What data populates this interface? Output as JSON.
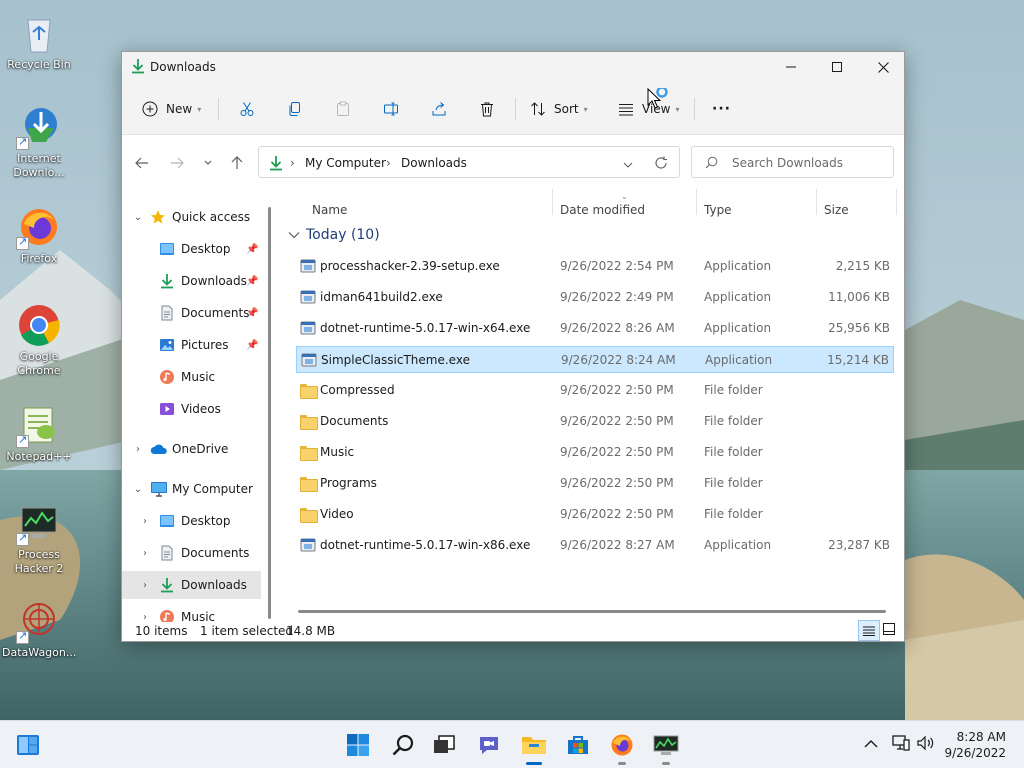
{
  "desktop": {
    "icons": [
      {
        "label": "Recycle Bin",
        "icon": "recycle-bin-icon"
      },
      {
        "label": "Internet Downlo...",
        "icon": "internet-download-manager-icon"
      },
      {
        "label": "Firefox",
        "icon": "firefox-icon"
      },
      {
        "label": "Google Chrome",
        "icon": "chrome-icon"
      },
      {
        "label": "Notepad++",
        "icon": "notepad-plus-plus-icon"
      },
      {
        "label": "Process Hacker 2",
        "icon": "process-hacker-icon"
      },
      {
        "label": "DataWagon...",
        "icon": "datawagon-icon"
      }
    ]
  },
  "window": {
    "title": "Downloads",
    "commands": {
      "new_label": "New",
      "sort_label": "Sort",
      "view_label": "View",
      "more_label": "···"
    },
    "address": {
      "crumbs": [
        "My Computer",
        "Downloads"
      ]
    },
    "search": {
      "placeholder": "Search Downloads"
    },
    "sidebar": {
      "items": [
        {
          "label": "Quick access",
          "icon": "star-icon",
          "level": 0,
          "expanded": true
        },
        {
          "label": "Desktop",
          "icon": "desktop-folder-icon",
          "level": 1,
          "pinned": true
        },
        {
          "label": "Downloads",
          "icon": "downloads-icon",
          "level": 1,
          "pinned": true
        },
        {
          "label": "Documents",
          "icon": "documents-icon",
          "level": 1,
          "pinned": true
        },
        {
          "label": "Pictures",
          "icon": "pictures-icon",
          "level": 1,
          "pinned": true
        },
        {
          "label": "Music",
          "icon": "music-icon",
          "level": 1
        },
        {
          "label": "Videos",
          "icon": "videos-icon",
          "level": 1
        },
        {
          "label": "OneDrive",
          "icon": "onedrive-icon",
          "level": 0,
          "expanded": false
        },
        {
          "label": "My Computer",
          "icon": "computer-icon",
          "level": 0,
          "expanded": true
        },
        {
          "label": "Desktop",
          "icon": "desktop-folder-icon",
          "level": 1,
          "expanded": false
        },
        {
          "label": "Documents",
          "icon": "documents-icon",
          "level": 1,
          "expanded": false
        },
        {
          "label": "Downloads",
          "icon": "downloads-icon",
          "level": 1,
          "expanded": false,
          "selected": true
        },
        {
          "label": "Music",
          "icon": "music-icon",
          "level": 1,
          "expanded": false
        }
      ]
    },
    "columns": {
      "name": "Name",
      "date": "Date modified",
      "type": "Type",
      "size": "Size"
    },
    "group_label": "Today (10)",
    "files": [
      {
        "name": "processhacker-2.39-setup.exe",
        "date": "9/26/2022 2:54 PM",
        "type": "Application",
        "size": "2,215 KB",
        "kind": "app"
      },
      {
        "name": "idman641build2.exe",
        "date": "9/26/2022 2:49 PM",
        "type": "Application",
        "size": "11,006 KB",
        "kind": "app"
      },
      {
        "name": "dotnet-runtime-5.0.17-win-x64.exe",
        "date": "9/26/2022 8:26 AM",
        "type": "Application",
        "size": "25,956 KB",
        "kind": "app"
      },
      {
        "name": "SimpleClassicTheme.exe",
        "date": "9/26/2022 8:24 AM",
        "type": "Application",
        "size": "15,214 KB",
        "kind": "app",
        "selected": true
      },
      {
        "name": "Compressed",
        "date": "9/26/2022 2:50 PM",
        "type": "File folder",
        "size": "",
        "kind": "folder"
      },
      {
        "name": "Documents",
        "date": "9/26/2022 2:50 PM",
        "type": "File folder",
        "size": "",
        "kind": "folder"
      },
      {
        "name": "Music",
        "date": "9/26/2022 2:50 PM",
        "type": "File folder",
        "size": "",
        "kind": "folder"
      },
      {
        "name": "Programs",
        "date": "9/26/2022 2:50 PM",
        "type": "File folder",
        "size": "",
        "kind": "folder"
      },
      {
        "name": "Video",
        "date": "9/26/2022 2:50 PM",
        "type": "File folder",
        "size": "",
        "kind": "folder"
      },
      {
        "name": "dotnet-runtime-5.0.17-win-x86.exe",
        "date": "9/26/2022 8:27 AM",
        "type": "Application",
        "size": "23,287 KB",
        "kind": "app"
      }
    ],
    "status": {
      "count": "10 items",
      "selection": "1 item selected",
      "size": "14.8 MB"
    }
  },
  "taskbar": {
    "apps": [
      {
        "name": "start-button",
        "icon": "windows-logo-icon"
      },
      {
        "name": "search-button",
        "icon": "search-icon"
      },
      {
        "name": "task-view-button",
        "icon": "task-view-icon"
      },
      {
        "name": "chat-button",
        "icon": "chat-icon"
      },
      {
        "name": "file-explorer-button",
        "icon": "file-explorer-icon",
        "active": true
      },
      {
        "name": "store-button",
        "icon": "store-icon"
      },
      {
        "name": "firefox-button",
        "icon": "firefox-icon"
      },
      {
        "name": "process-hacker-button",
        "icon": "process-hacker-icon"
      }
    ],
    "clock": {
      "time": "8:28 AM",
      "date": "9/26/2022"
    }
  },
  "colors": {
    "accent": "#0067c0",
    "selection_bg": "#cce8ff",
    "selection_border": "#99d1ff",
    "group_header": "#1e3f7a"
  }
}
